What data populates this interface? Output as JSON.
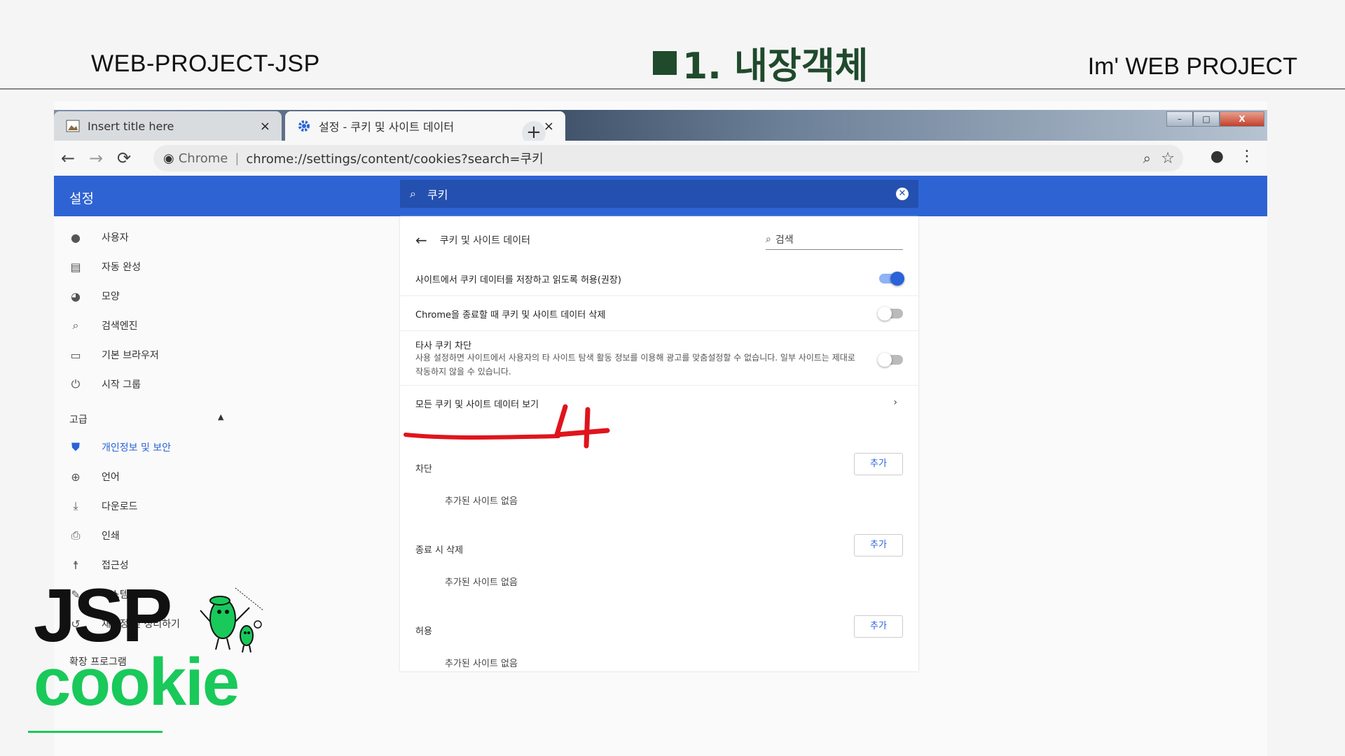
{
  "slide": {
    "left_label": "WEB-PROJECT-JSP",
    "title": "1. 내장객체",
    "right_label": "Im'  WEB PROJECT"
  },
  "browser": {
    "tabs": [
      {
        "label": "Insert title here",
        "icon": "image-icon",
        "close": "×"
      },
      {
        "label": "설정 - 쿠키 및 사이트 데이터",
        "icon": "gear-icon",
        "close": "×"
      }
    ],
    "new_tab": "+",
    "window_controls": {
      "minimize": "–",
      "maximize": "□",
      "close": "X"
    },
    "omnibox": {
      "site_label": "Chrome",
      "url": "chrome://settings/content/cookies?search=쿠키"
    }
  },
  "settings": {
    "title": "설정",
    "search_query": "쿠키",
    "sidebar": [
      {
        "label": "사용자",
        "icon": "person-icon"
      },
      {
        "label": "자동 완성",
        "icon": "clipboard-icon"
      },
      {
        "label": "모양",
        "icon": "palette-icon"
      },
      {
        "label": "검색엔진",
        "icon": "search-icon"
      },
      {
        "label": "기본 브라우저",
        "icon": "browser-icon"
      },
      {
        "label": "시작 그룹",
        "icon": "power-icon"
      }
    ],
    "advanced_label": "고급",
    "advanced_items": [
      {
        "label": "개인정보 및 보안",
        "icon": "shield-icon",
        "active": true
      },
      {
        "label": "언어",
        "icon": "globe-icon"
      },
      {
        "label": "다운로드",
        "icon": "download-icon"
      },
      {
        "label": "인쇄",
        "icon": "printer-icon"
      },
      {
        "label": "접근성",
        "icon": "accessibility-icon"
      },
      {
        "label": "시스템",
        "icon": "wrench-icon"
      },
      {
        "label": "재설정 및 정리하기",
        "icon": "reset-icon"
      }
    ],
    "extensions_label": "확장 프로그램",
    "page_header": "쿠키 및 사이트 데이터",
    "page_search_placeholder": "검색",
    "rows": [
      {
        "label": "사이트에서 쿠키 데이터를 저장하고 읽도록 허용(권장)",
        "toggle": true
      },
      {
        "label": "Chrome을 종료할 때 쿠키 및 사이트 데이터 삭제",
        "toggle": false
      },
      {
        "label": "타사 쿠키 차단",
        "description": "사용 설정하면 사이트에서 사용자의 타 사이트 탐색 활동 정보를 이용해 광고를 맞춤설정할 수 없습니다. 일부 사이트는 제대로 작동하지 않을 수 있습니다.",
        "toggle": false
      },
      {
        "label": "모든 쿠키 및 사이트 데이터 보기"
      }
    ],
    "sections": [
      {
        "label": "차단",
        "add": "추가",
        "empty": "추가된 사이트 없음"
      },
      {
        "label": "종료 시 삭제",
        "add": "추가",
        "empty": "추가된 사이트 없음"
      },
      {
        "label": "허용",
        "add": "추가",
        "empty": "추가된 사이트 없음"
      }
    ]
  },
  "annotation": {
    "number": "4",
    "color": "#e0141c"
  },
  "overlay": {
    "title": "JSP",
    "subtitle": "cookie",
    "accent": "#19c95a"
  },
  "colors": {
    "settings_blue": "#2e63d4",
    "slide_title": "#1f4a2c"
  }
}
